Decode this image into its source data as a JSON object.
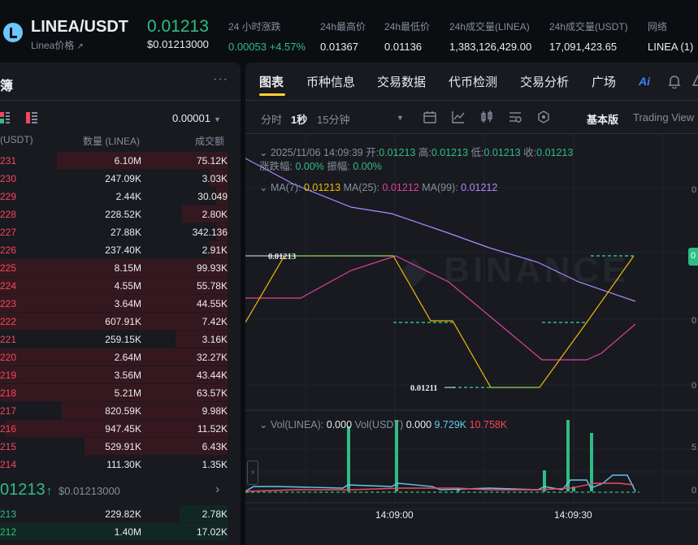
{
  "header": {
    "pair": "LINEA/USDT",
    "subtitle": "Linea价格",
    "last_price": "0.01213",
    "last_price_usd": "$0.01213000",
    "stats": [
      {
        "label": "24 小时涨跌",
        "value": "0.00053 +4.57%",
        "green": true
      },
      {
        "label": "24h最高价",
        "value": "0.01367"
      },
      {
        "label": "24h最低价",
        "value": "0.01136"
      },
      {
        "label": "24h成交量(LINEA)",
        "value": "1,383,126,429.00"
      },
      {
        "label": "24h成交量(USDT)",
        "value": "17,091,423.65"
      },
      {
        "label": "网络",
        "value": "LINEA (1)"
      }
    ]
  },
  "orderbook": {
    "title": "簿",
    "more": "···",
    "precision": "0.00001",
    "columns": {
      "price": "(USDT)",
      "qty": "数量 (LINEA)",
      "total": "成交额"
    },
    "asks": [
      {
        "p": "231",
        "q": "6.10M",
        "t": "75.12K",
        "d": 0.75
      },
      {
        "p": "230",
        "q": "247.09K",
        "t": "3.03K",
        "d": 0.08
      },
      {
        "p": "229",
        "q": "2.44K",
        "t": "30.049",
        "d": 0.05
      },
      {
        "p": "228",
        "q": "228.52K",
        "t": "2.80K",
        "d": 0.2
      },
      {
        "p": "227",
        "q": "27.88K",
        "t": "342.136",
        "d": 0.05
      },
      {
        "p": "226",
        "q": "237.40K",
        "t": "2.91K",
        "d": 0.08
      },
      {
        "p": "225",
        "q": "8.15M",
        "t": "99.93K",
        "d": 1.0
      },
      {
        "p": "224",
        "q": "4.55M",
        "t": "55.78K",
        "d": 1.0
      },
      {
        "p": "223",
        "q": "3.64M",
        "t": "44.55K",
        "d": 1.0
      },
      {
        "p": "222",
        "q": "607.91K",
        "t": "7.42K",
        "d": 1.0
      },
      {
        "p": "221",
        "q": "259.15K",
        "t": "3.16K",
        "d": 0.23
      },
      {
        "p": "220",
        "q": "2.64M",
        "t": "32.27K",
        "d": 1.0
      },
      {
        "p": "219",
        "q": "3.56M",
        "t": "43.44K",
        "d": 1.0
      },
      {
        "p": "218",
        "q": "5.21M",
        "t": "63.57K",
        "d": 1.0
      },
      {
        "p": "217",
        "q": "820.59K",
        "t": "9.98K",
        "d": 0.73
      },
      {
        "p": "216",
        "q": "947.45K",
        "t": "11.52K",
        "d": 0.98
      },
      {
        "p": "215",
        "q": "529.91K",
        "t": "6.43K",
        "d": 0.63
      },
      {
        "p": "214",
        "q": "111.30K",
        "t": "1.35K",
        "d": 0.0
      }
    ],
    "mid_price": "01213",
    "mid_arrow": "↑",
    "mid_usd": "$0.01213000",
    "mid_chevron": "›",
    "bids": [
      {
        "p": "213",
        "q": "229.82K",
        "t": "2.78K",
        "d": 0.21
      },
      {
        "p": "212",
        "q": "1.40M",
        "t": "17.02K",
        "d": 1.0
      }
    ]
  },
  "chart_panel": {
    "tabs": [
      "图表",
      "币种信息",
      "交易数据",
      "代币检测",
      "交易分析",
      "广场"
    ],
    "ai_label": "Ai",
    "timeframes": [
      "分时",
      "1秒",
      "15分钟"
    ],
    "version": "基本版",
    "tradingview": "Trading View",
    "ohlc": {
      "date": "2025/11/06 14:09:39",
      "open_label": "开:",
      "open": "0.01213",
      "high_label": "高:",
      "high": "0.01213",
      "low_label": "低:",
      "low": "0.01213",
      "close_label": "收:",
      "close": "0.01213",
      "chg_label": "涨跌幅:",
      "chg": "0.00%",
      "amp_label": "振幅:",
      "amp": "0.00%"
    },
    "ma": {
      "ma7_label": "MA(7):",
      "ma7": "0.01213",
      "ma25_label": "MA(25):",
      "ma25": "0.01212",
      "ma99_label": "MA(99):",
      "ma99": "0.01212"
    },
    "vol": {
      "label": "Vol(LINEA):",
      "v1": "0.000",
      "label2": "Vol(USDT)",
      "v2": "0.000",
      "v3": "9.729K",
      "v4": "10.758K"
    },
    "price_marks": {
      "high": "0.01213",
      "low": "0.01211"
    },
    "time_labels": [
      "14:09:00",
      "14:09:30"
    ],
    "y_labels": [
      "0",
      "0",
      "0",
      "0",
      "5",
      "0"
    ],
    "price_tag": "0",
    "side_button": "›",
    "colors": {
      "up": "#2ebd85",
      "down": "#f6465d",
      "ma7": "#f0b90b",
      "ma25": "#e040a0",
      "ma99": "#b388ff",
      "vol_ma": "#5ec8f2"
    }
  }
}
